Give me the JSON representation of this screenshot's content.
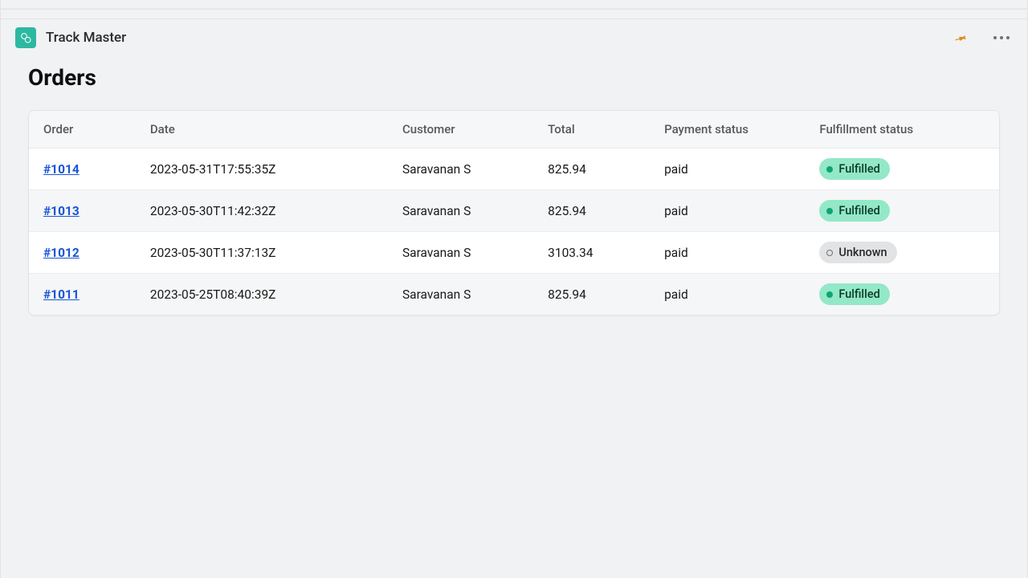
{
  "header": {
    "app_title": "Track Master"
  },
  "page": {
    "title": "Orders"
  },
  "table": {
    "columns": {
      "order": "Order",
      "date": "Date",
      "customer": "Customer",
      "total": "Total",
      "payment_status": "Payment status",
      "fulfillment_status": "Fulfillment status"
    },
    "rows": [
      {
        "order": "#1014",
        "date": "2023-05-31T17:55:35Z",
        "customer": "Saravanan S",
        "total": "825.94",
        "payment_status": "paid",
        "fulfillment_status": "Fulfilled",
        "fulfillment_kind": "fulfilled"
      },
      {
        "order": "#1013",
        "date": "2023-05-30T11:42:32Z",
        "customer": "Saravanan S",
        "total": "825.94",
        "payment_status": "paid",
        "fulfillment_status": "Fulfilled",
        "fulfillment_kind": "fulfilled"
      },
      {
        "order": "#1012",
        "date": "2023-05-30T11:37:13Z",
        "customer": "Saravanan S",
        "total": "3103.34",
        "payment_status": "paid",
        "fulfillment_status": "Unknown",
        "fulfillment_kind": "unknown"
      },
      {
        "order": "#1011",
        "date": "2023-05-25T08:40:39Z",
        "customer": "Saravanan S",
        "total": "825.94",
        "payment_status": "paid",
        "fulfillment_status": "Fulfilled",
        "fulfillment_kind": "fulfilled"
      }
    ]
  },
  "icons": {
    "app": "app-logo-icon",
    "pin": "pin-icon",
    "more": "more-icon"
  },
  "colors": {
    "link": "#1a56d6",
    "fulfilled_bg": "#93e8c8",
    "fulfilled_dot": "#0ea473",
    "unknown_bg": "#e1e3e5",
    "pin": "#e38b17",
    "app_icon_bg": "#2db8a1"
  }
}
